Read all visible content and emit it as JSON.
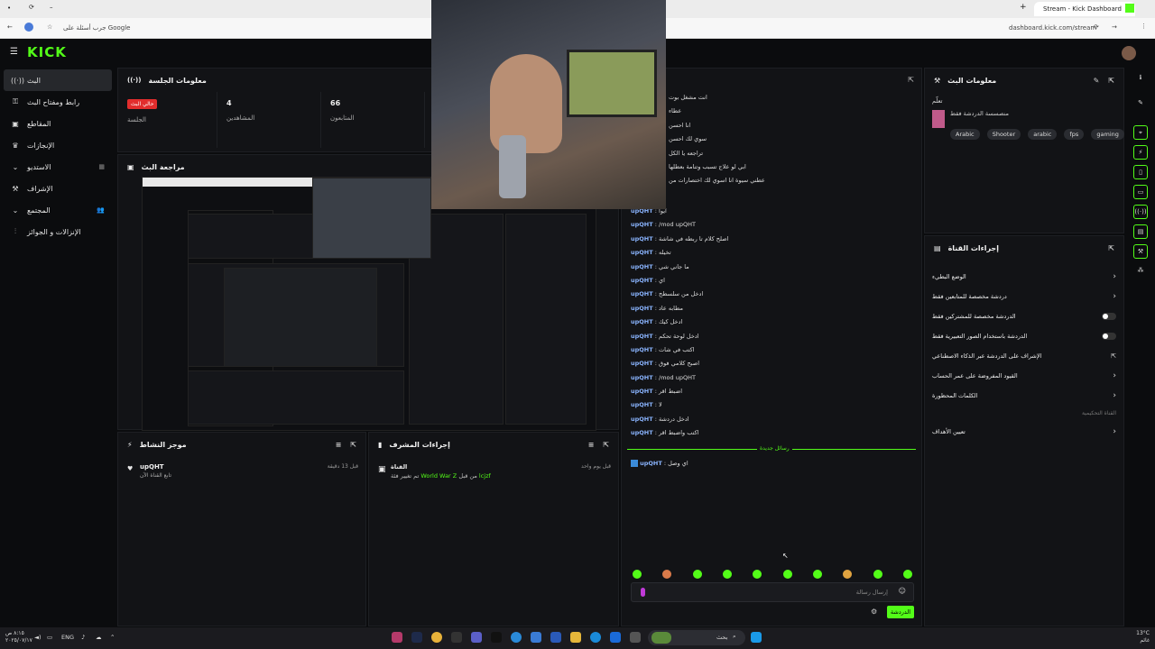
{
  "browser": {
    "tab_title": "Stream - Kick Dashboard",
    "new_tab": "+",
    "url": "dashboard.kick.com/stream",
    "search_hint": "جرب أسئلة على Google"
  },
  "app": {
    "logo": "KICK",
    "accent": "#53fc18"
  },
  "sidebar": {
    "items": [
      {
        "label": "البث",
        "icon": "live-icon",
        "active": true
      },
      {
        "label": "رابط ومفتاح البث",
        "icon": "link-icon"
      },
      {
        "label": "المقاطع",
        "icon": "clips-icon"
      },
      {
        "label": "الإنجازات",
        "icon": "trophy-icon"
      },
      {
        "label": "الاستديو",
        "icon": "studio-icon"
      },
      {
        "label": "الإشراف",
        "icon": "mod-icon"
      },
      {
        "label": "المجتمع",
        "icon": "community-icon"
      },
      {
        "label": "الإنزالات و الجوائز",
        "icon": "drops-icon"
      }
    ]
  },
  "session": {
    "title": "معلومات الجلسة",
    "live_badge": "حالي البث",
    "stats": [
      {
        "value": "",
        "label": "الجلسة"
      },
      {
        "value": "4",
        "label": "المشاهدين"
      },
      {
        "value": "66",
        "label": "المتابعون"
      }
    ]
  },
  "preview": {
    "title": "مراجعة البث"
  },
  "activity": {
    "title": "موجز النشاط",
    "items": [
      {
        "user": "upQHT",
        "text": "تابع القناة الآن",
        "time": "قبل 13 دقيقة"
      }
    ]
  },
  "mod_actions": {
    "title": "إجراءات المشرف",
    "items": [
      {
        "title": "القناة",
        "text": "تم تغيير فئة",
        "game": "World War Z",
        "from": "من قبل",
        "by": "lcjzf",
        "time": "قبل يوم واحد"
      }
    ]
  },
  "chat": {
    "top_lines": [
      "انت مشغل بوت",
      "عطاء",
      "انا احسن",
      "سوي لك احسن",
      "تراجعه يا الكل",
      "ابي لو علاج تسبب وتنامة بعطلها",
      "عطني سيوة انا اسوي لك اختصارات من"
    ],
    "lines": [
      {
        "user": "upQHT",
        "text": ": ايوا"
      },
      {
        "user": "upQHT",
        "text": ": /mod upQHT"
      },
      {
        "user": "upQHT",
        "text": ": اصلح كلام تا ربطه في شاشة"
      },
      {
        "user": "upQHT",
        "text": ": تخيله"
      },
      {
        "user": "upQHT",
        "text": ": ما جاني شي"
      },
      {
        "user": "upQHT",
        "text": ": اي"
      },
      {
        "user": "upQHT",
        "text": ": ادخل من سلسطح"
      },
      {
        "user": "upQHT",
        "text": ": مطابه عاد"
      },
      {
        "user": "upQHT",
        "text": ": ادخل كيك"
      },
      {
        "user": "upQHT",
        "text": ": ادخل لوحة تحكم"
      },
      {
        "user": "upQHT",
        "text": ": اكتب في شات"
      },
      {
        "user": "upQHT",
        "text": ": اصبح كلامي فوق"
      },
      {
        "user": "upQHT",
        "text": ": /mod upQHT"
      },
      {
        "user": "upQHT",
        "text": ": اضبط اقر"
      },
      {
        "user": "upQHT",
        "text": ": لا"
      },
      {
        "user": "upQHT",
        "text": ": ادخل دردشة"
      },
      {
        "user": "upQHT",
        "text": ": اكتب واضبط اقر"
      }
    ],
    "divider": "رسائل جديدة",
    "new_line": {
      "user": "upQHT",
      "text": ": اي وصل"
    },
    "input_placeholder": "إرسال رسالة",
    "send_label": "الدردشة"
  },
  "stream_info": {
    "title": "معلومات البث",
    "label": "تعلّم",
    "subtitle": "منصسسة الدردشة فقط",
    "tags": [
      "Arabic",
      "Shooter",
      "arabic",
      "fps",
      "gaming"
    ]
  },
  "channel_actions": {
    "title": "إجراءات القناة",
    "items": [
      {
        "label": "الوضع البطيء",
        "kind": "chevron"
      },
      {
        "label": "دردشة مخصصة للمتابعين فقط",
        "kind": "chevron"
      },
      {
        "label": "الدردشة مخصصة للمشتركين فقط",
        "kind": "toggle"
      },
      {
        "label": "الدردشة باستخدام الصور التعبيرية فقط",
        "kind": "toggle"
      },
      {
        "label": "الإشراف على الدردشة عبر الذكاء الاصطناعي",
        "kind": "external"
      },
      {
        "label": "القيود المفروضة على عمر الحساب",
        "kind": "chevron"
      },
      {
        "label": "الكلمات المحظورة",
        "kind": "chevron"
      }
    ],
    "group_label": "القناة التحكيمية",
    "goal_label": "تعيين الأهداف"
  },
  "taskbar": {
    "lang": "ENG",
    "search": "بحث",
    "weather": "13°C",
    "weather_sub": "غائم",
    "time": "٨:١٥ ص",
    "date": "٢٠٢٥/٠٧/١٧"
  }
}
